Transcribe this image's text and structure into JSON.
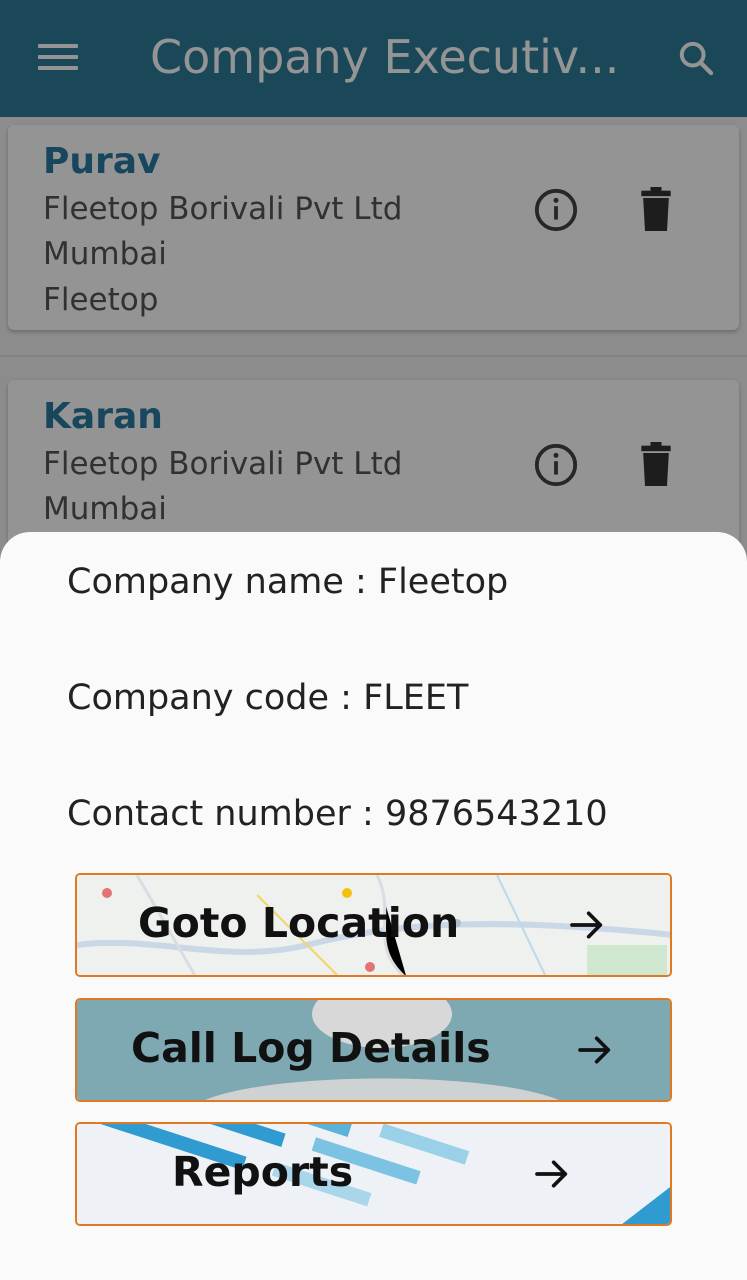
{
  "appbar": {
    "title": "Company Executiv...",
    "menu_icon": "menu-icon",
    "search_icon": "search-icon",
    "color": "#2f7d9a"
  },
  "list": [
    {
      "name": "Purav",
      "company": "Fleetop Borivali Pvt Ltd",
      "city": "Mumbai",
      "group": "Fleetop"
    },
    {
      "name": "Karan",
      "company": "Fleetop Borivali Pvt Ltd",
      "city": "Mumbai"
    }
  ],
  "sheet": {
    "company_name": "Company name : Fleetop",
    "company_code": "Company code : FLEET",
    "contact_number": "Contact number : 9876543210",
    "actions": {
      "goto_location": "Goto Location",
      "call_log": "Call Log Details",
      "reports": "Reports"
    },
    "accent": "#e07a22"
  }
}
